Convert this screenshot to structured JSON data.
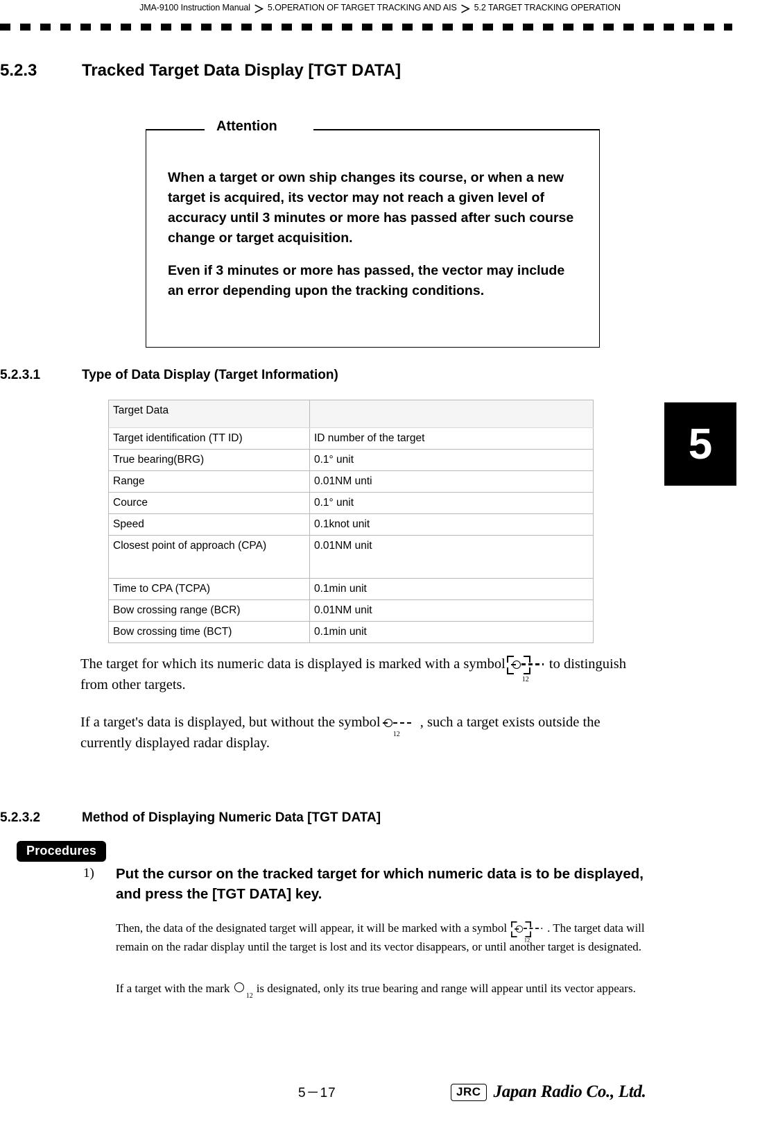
{
  "header": {
    "manual": "JMA-9100 Instruction Manual",
    "separator": "＞",
    "chapter": "5.OPERATION OF TARGET TRACKING AND AIS",
    "section": "5.2  TARGET TRACKING OPERATION"
  },
  "chapter_tab": {
    "number": "5"
  },
  "heading_523": {
    "number": "5.2.3",
    "text": "Tracked Target Data Display [TGT DATA]"
  },
  "attention": {
    "label": "Attention",
    "paragraphs": [
      "When a target or own ship changes its course, or when a new target is acquired, its vector may not reach a given level of accuracy until 3 minutes or more has passed after such course change or target acquisition.",
      "Even if 3 minutes or more has passed, the vector may include an error depending upon the tracking conditions."
    ]
  },
  "heading_5231": {
    "number": "5.2.3.1",
    "text": "Type of Data Display (Target Information)"
  },
  "table": {
    "rows": [
      {
        "label": "Target Data",
        "value": ""
      },
      {
        "label": "Target identification (TT ID)",
        "value": "ID number of the target"
      },
      {
        "label": "True bearing(BRG)",
        "value": "0.1° unit"
      },
      {
        "label": "Range",
        "value": "0.01NM unti"
      },
      {
        "label": "Cource",
        "value": "0.1° unit"
      },
      {
        "label": "Speed",
        "value": "0.1knot unit"
      },
      {
        "label": "Closest point of approach (CPA)",
        "value": "0.01NM unit"
      },
      {
        "label": "Time to CPA (TCPA)",
        "value": "0.1min unit"
      },
      {
        "label": "Bow crossing range (BCR)",
        "value": "0.01NM unit"
      },
      {
        "label": "Bow crossing time (BCT)",
        "value": "0.1min unit"
      }
    ]
  },
  "paragraphs": {
    "marked_symbol_pre": "The target for which its numeric data is displayed is marked with a symbol",
    "marked_symbol_post": "to distinguish from other targets.",
    "outside_pre": "If a target's data is displayed, but without the symbol",
    "outside_post": ", such a target exists outside the currently displayed radar display."
  },
  "heading_5232": {
    "number": "5.2.3.2",
    "text": "Method of Displaying Numeric Data [TGT DATA]"
  },
  "procedures": {
    "badge": "Procedures",
    "step_number": "1)",
    "step_text": "Put the cursor on the tracked target for which numeric data is to be displayed, and press the [TGT DATA] key.",
    "note1_pre": "Then, the data of the designated target will appear, it will be marked with a symbol",
    "note1_post": ". The target data will remain on the radar display until the target is lost and its vector disappears, or until another target is designated.",
    "note2_pre": "If a target with the mark",
    "note2_post": "is designated, only its true bearing and range will appear until its vector appears."
  },
  "symbol": {
    "subscript": "12"
  },
  "footer": {
    "page": "5－17",
    "logo_mark": "JRC",
    "company": "Japan Radio Co., Ltd."
  }
}
